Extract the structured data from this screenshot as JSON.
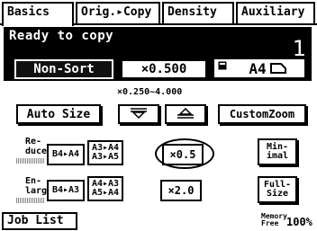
{
  "tabs": {
    "basics": "Basics",
    "orig_copy": "Orig.▸Copy",
    "density": "Density",
    "auxiliary": "Auxiliary"
  },
  "status": {
    "message": "Ready to copy",
    "copies": "1"
  },
  "settings": {
    "sort": "Non-Sort",
    "zoom": "×0.500",
    "paper": "A4",
    "paper_orientation_icon": "landscape-paper-icon",
    "tray_icon": "tray-icon",
    "zoom_range": "×0.250~4.000"
  },
  "zoom_controls": {
    "auto_size": "Auto Size",
    "down_icon": "zoom-down-icon",
    "up_icon": "zoom-up-icon",
    "custom_zoom": "CustomZoom"
  },
  "reduce": {
    "label_line1": "Re-",
    "label_line2": "duce",
    "b4_a4": "B4▸A4",
    "a3_a4_top": "A3▸A4",
    "a3_a4_bottom": "A3▸A5",
    "x05": "×0.5",
    "minimal_line1": "Min-",
    "minimal_line2": "imal"
  },
  "enlarge": {
    "label_line1": "En-",
    "label_line2": "large",
    "b4_a3": "B4▸A3",
    "a4_a3_top": "A4▸A3",
    "a4_a3_bottom": "A5▸A4",
    "x20": "×2.0",
    "fullsize_line1": "Full-",
    "fullsize_line2": "Size"
  },
  "footer": {
    "job_list": "Job List",
    "memory_free_line1": "Memory",
    "memory_free_line2": "Free",
    "memory_value": "100%"
  }
}
